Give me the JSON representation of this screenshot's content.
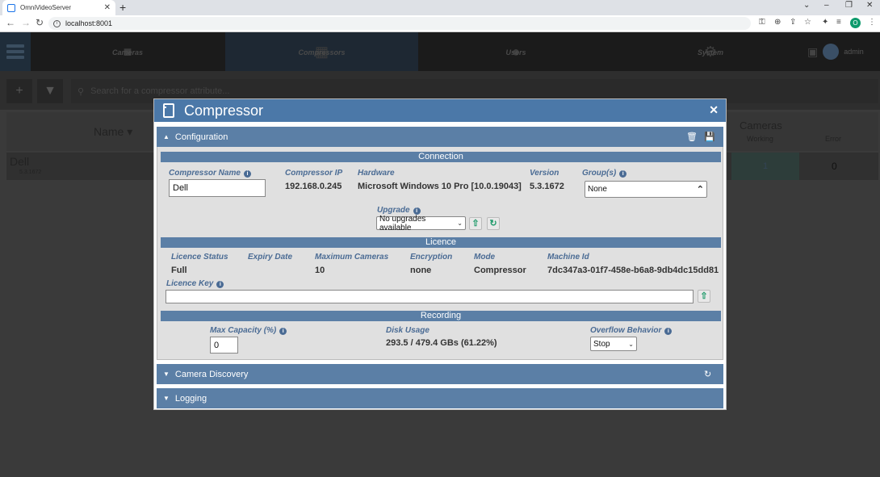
{
  "browser": {
    "tab_title": "OmniVideoServer",
    "url": "localhost:8001",
    "profile_initial": "O"
  },
  "app_nav": {
    "items": [
      {
        "label": "Cameras"
      },
      {
        "label": "Compressors"
      },
      {
        "label": "Users"
      },
      {
        "label": "System"
      }
    ],
    "user": "admin"
  },
  "background": {
    "search_placeholder": "Search for a compressor attribute...",
    "name_header": "Name",
    "cameras_header": "Cameras",
    "working_header": "Working",
    "error_header": "Error",
    "row_name": "Dell",
    "row_version": "5.3.1672",
    "row_working": "1",
    "row_error": "0"
  },
  "modal": {
    "title": "Compressor",
    "configuration_label": "Configuration",
    "camera_discovery_label": "Camera Discovery",
    "logging_label": "Logging",
    "connection": {
      "section": "Connection",
      "compressor_name_label": "Compressor Name",
      "compressor_name_value": "Dell",
      "compressor_ip_label": "Compressor IP",
      "compressor_ip_value": "192.168.0.245",
      "hardware_label": "Hardware",
      "hardware_value": "Microsoft Windows 10 Pro [10.0.19043]",
      "version_label": "Version",
      "version_value": "5.3.1672",
      "groups_label": "Group(s)",
      "groups_value": "None",
      "upgrade_label": "Upgrade",
      "upgrade_value": "No upgrades available"
    },
    "licence": {
      "section": "Licence",
      "status_label": "Licence Status",
      "status_value": "Full",
      "expiry_label": "Expiry Date",
      "expiry_value": "",
      "max_cameras_label": "Maximum Cameras",
      "max_cameras_value": "10",
      "encryption_label": "Encryption",
      "encryption_value": "none",
      "mode_label": "Mode",
      "mode_value": "Compressor",
      "machine_id_label": "Machine Id",
      "machine_id_value": "7dc347a3-01f7-458e-b6a8-9db4dc15dd81",
      "licence_key_label": "Licence Key",
      "licence_key_value": ""
    },
    "recording": {
      "section": "Recording",
      "max_capacity_label": "Max Capacity (%)",
      "max_capacity_value": "0",
      "disk_usage_label": "Disk Usage",
      "disk_usage_value": "293.5 / 479.4 GBs (61.22%)",
      "overflow_label": "Overflow Behavior",
      "overflow_value": "Stop"
    }
  }
}
